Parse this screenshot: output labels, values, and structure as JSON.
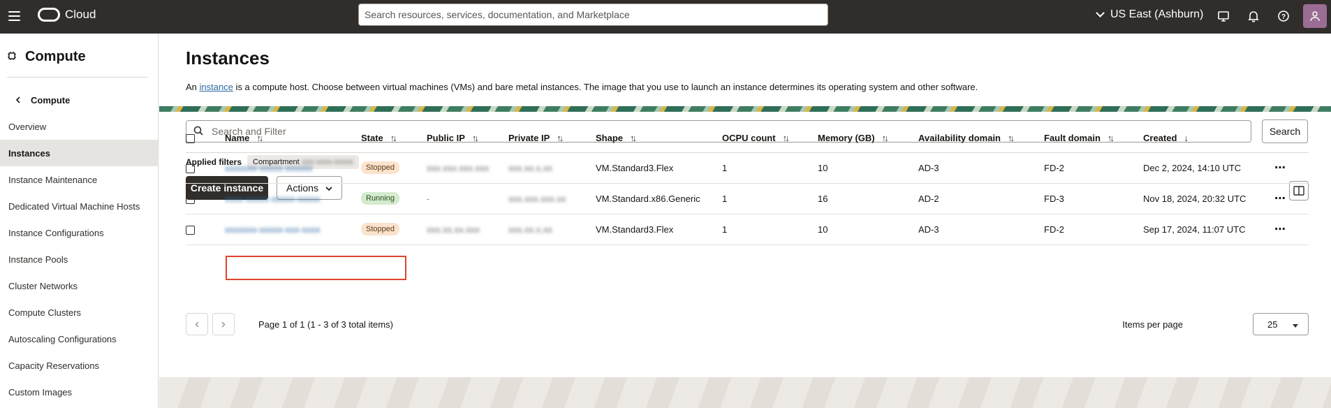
{
  "topbar": {
    "brand": "Cloud",
    "search_placeholder": "Search resources, services, documentation, and Marketplace",
    "region": "US East (Ashburn)",
    "icons": [
      "hamburger-icon",
      "cloud-shell-icon",
      "notifications-icon",
      "help-icon",
      "user-avatar-icon"
    ]
  },
  "sidebar": {
    "title": "Compute",
    "back_label": "Compute",
    "items": [
      {
        "label": "Overview"
      },
      {
        "label": "Instances",
        "active": true
      },
      {
        "label": "Instance Maintenance"
      },
      {
        "label": "Dedicated Virtual Machine Hosts"
      },
      {
        "label": "Instance Configurations"
      },
      {
        "label": "Instance Pools"
      },
      {
        "label": "Cluster Networks"
      },
      {
        "label": "Compute Clusters"
      },
      {
        "label": "Autoscaling Configurations"
      },
      {
        "label": "Capacity Reservations"
      },
      {
        "label": "Custom Images"
      }
    ]
  },
  "main": {
    "title": "Instances",
    "desc_prefix": "An ",
    "desc_link": "instance",
    "desc_suffix": " is a compute host. Choose between virtual machines (VMs) and bare metal instances. The image that you use to launch an instance determines its operating system and other software.",
    "filter_placeholder": "Search and Filter",
    "search_button": "Search",
    "applied_filters_label": "Applied filters",
    "chip_label": "Compartment",
    "chip_value": "xxx-xxxx-xxxxx",
    "create_button": "Create instance",
    "actions_button": "Actions"
  },
  "table": {
    "headers": [
      "Name",
      "State",
      "Public IP",
      "Private IP",
      "Shape",
      "OCPU count",
      "Memory (GB)",
      "Availability domain",
      "Fault domain",
      "Created"
    ],
    "rows": [
      {
        "name": "xxxxxxx-xxxxx-xxxxxx",
        "state": "Stopped",
        "public_ip": "xxx.xxx.xxx.xxx",
        "private_ip": "xxx.xx.x.xx",
        "shape": "VM.Standard3.Flex",
        "ocpu": "1",
        "memory": "10",
        "ad": "AD-3",
        "fd": "FD-2",
        "created": "Dec 2, 2024, 14:10 UTC"
      },
      {
        "name": "xxxx-xxxxx-xxxxx-xxxxx",
        "state": "Running",
        "public_ip": "-",
        "private_ip": "xxx.xxx.xxx.xx",
        "shape": "VM.Standard.x86.Generic",
        "ocpu": "1",
        "memory": "16",
        "ad": "AD-2",
        "fd": "FD-3",
        "created": "Nov 18, 2024, 20:32 UTC"
      },
      {
        "name": "xxxxxxx-xxxxx-xxx-xxxx",
        "state": "Stopped",
        "public_ip": "xxx.xx.xx.xxx",
        "private_ip": "xxx.xx.x.xx",
        "shape": "VM.Standard3.Flex",
        "ocpu": "1",
        "memory": "10",
        "ad": "AD-3",
        "fd": "FD-2",
        "created": "Sep 17, 2024, 11:07 UTC"
      }
    ]
  },
  "pager": {
    "info": "Page 1 of 1 (1 - 3 of 3 total items)",
    "per_page_label": "Items per page",
    "per_page_value": "25"
  },
  "colors": {
    "topbar": "#312d2a",
    "primary_button": "#312d2a",
    "link": "#2c6aa5",
    "stopped_badge": "#fbe3cd",
    "running_badge": "#d4ebcd",
    "highlight": "#e0442e"
  }
}
